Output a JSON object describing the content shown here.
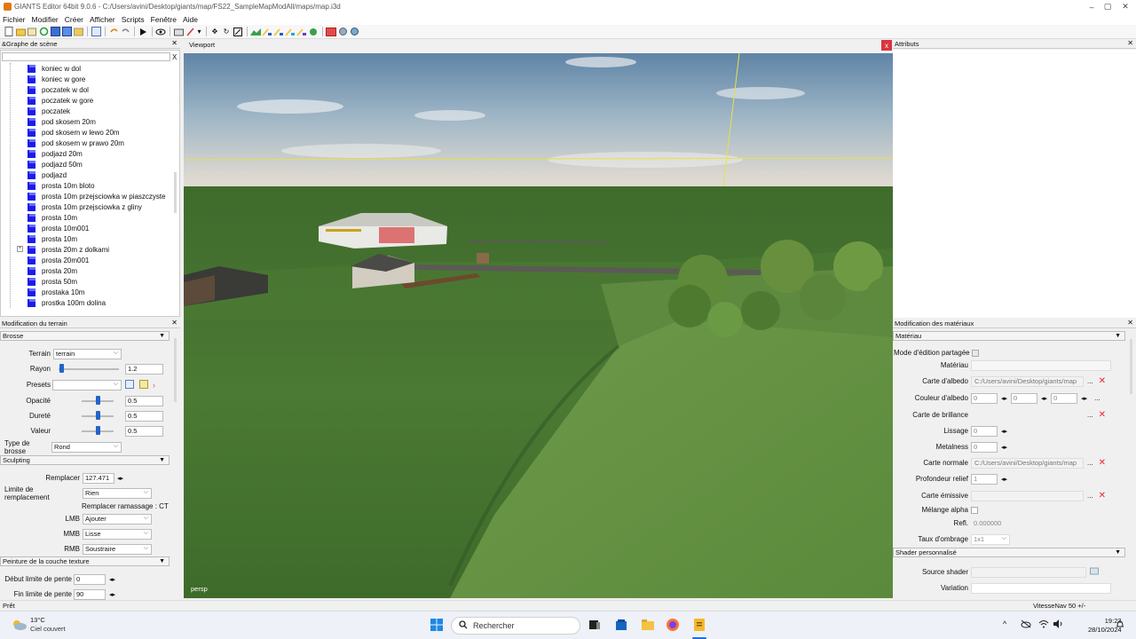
{
  "window": {
    "title": "GIANTS Editor 64bit 9.0.6 - C:/Users/avini/Desktop/giants/map/FS22_SampleMapModAll/maps/map.i3d",
    "minimize": "–",
    "maximize": "▢",
    "close": "✕"
  },
  "menu": [
    "Fichier",
    "Modifier",
    "Créer",
    "Afficher",
    "Scripts",
    "Fenêtre",
    "Aide"
  ],
  "scene_graph": {
    "title": "&Graphe de scène",
    "close": "✕",
    "search_clear": "X",
    "items": [
      {
        "label": "koniec  w  dol",
        "expander": false
      },
      {
        "label": "koniec w gore",
        "expander": false
      },
      {
        "label": "poczatek w  dol",
        "expander": false
      },
      {
        "label": "poczatek w gore",
        "expander": false
      },
      {
        "label": "poczatek",
        "expander": false
      },
      {
        "label": "pod skosem 20m",
        "expander": false
      },
      {
        "label": "pod skosem w lewo 20m",
        "expander": false
      },
      {
        "label": "pod skosem w prawo 20m",
        "expander": false
      },
      {
        "label": "podjazd 20m",
        "expander": false
      },
      {
        "label": "podjazd 50m",
        "expander": false
      },
      {
        "label": "podjazd",
        "expander": false
      },
      {
        "label": "prosta 10m bloto",
        "expander": false
      },
      {
        "label": "prosta 10m przejsciowka w piaszczyste",
        "expander": false
      },
      {
        "label": "prosta 10m przejsciowka z gliny",
        "expander": false
      },
      {
        "label": "prosta 10m",
        "expander": false
      },
      {
        "label": "prosta 10m001",
        "expander": false
      },
      {
        "label": "prosta 10m",
        "expander": false
      },
      {
        "label": "prosta 20m z dolkami",
        "expander": true
      },
      {
        "label": "prosta 20m001",
        "expander": false
      },
      {
        "label": "prosta 20m",
        "expander": false
      },
      {
        "label": "prosta 50m",
        "expander": false
      },
      {
        "label": "prostaka  10m",
        "expander": false
      },
      {
        "label": "prostka 100m dolina",
        "expander": false
      }
    ]
  },
  "terrain_panel": {
    "title": "Modification du terrain",
    "close": "✕",
    "brush_section": "Brosse",
    "terrain_label": "Terrain",
    "terrain_value": "terrain",
    "radius_label": "Rayon",
    "radius_value": "1.2",
    "presets_label": "Presets",
    "opacity_label": "Opacité",
    "opacity_value": "0.5",
    "hardness_label": "Dureté",
    "hardness_value": "0.5",
    "value_label": "Valeur",
    "value_value": "0.5",
    "brush_type_label": "Type de brosse",
    "brush_type_value": "Rond",
    "sculpt_section": "Sculpting",
    "replace_label": "Remplacer",
    "replace_value": "127.471",
    "replace_limit_label": "Limite de remplacement",
    "replace_limit_value": "Rien",
    "replace_pick_text": "Remplacer ramassage : CT",
    "lmb_label": "LMB",
    "lmb_value": "Ajouter",
    "mmb_label": "MMB",
    "mmb_value": "Lisse",
    "rmb_label": "RMB",
    "rmb_value": "Soustraire",
    "paint_section": "Peinture de la couche texture",
    "slope_start_label": "Début limite de pente",
    "slope_start_value": "0",
    "slope_end_label": "Fin limite de pente",
    "slope_end_value": "90",
    "slider_levels": {
      "radius": 0.05,
      "opacity": 0.5,
      "hardness": 0.5,
      "value": 0.5
    }
  },
  "viewport": {
    "title": "Viewport",
    "close": "x",
    "camera": "persp"
  },
  "attributes": {
    "title": "Attributs",
    "close": "✕"
  },
  "material_panel": {
    "title": "Modification des matériaux",
    "close": "✕",
    "material_section": "Matériau",
    "shared_edit_label": "Mode d'édition partagée",
    "material_label": "Matériau",
    "albedo_map_label": "Carte d'albedo",
    "albedo_map_value": "C:/Users/avini/Desktop/giants/map",
    "albedo_color_label": "Couleur d'albedo",
    "albedo_r": "0",
    "albedo_g": "0",
    "albedo_b": "0",
    "gloss_map_label": "Carte de brillance",
    "smoothness_label": "Lissage",
    "smoothness_value": "0",
    "metalness_label": "Metalness",
    "metalness_value": "0",
    "normal_map_label": "Carte normale",
    "normal_map_value": "C:/Users/avini/Desktop/giants/map",
    "relief_depth_label": "Profondeur relief",
    "relief_depth_value": "1",
    "emissive_map_label": "Carte émissive",
    "alpha_blend_label": "Mélange alpha",
    "refl_label": "Refl.",
    "refl_value": "0.000000",
    "shading_rate_label": "Taux d'ombrage",
    "shading_rate_value": "1x1",
    "shader_section": "Shader personnalisé",
    "shader_source_label": "Source shader",
    "variation_label": "Variation",
    "browse": "...",
    "arrows": "◂▸"
  },
  "status": {
    "left": "Prêt",
    "right": "VitesseNav 50 +/-"
  },
  "taskbar": {
    "temperature": "13°C",
    "weather": "Ciel couvert",
    "search_placeholder": "Rechercher",
    "time": "19:23",
    "date": "28/10/2024",
    "chevron": "^"
  }
}
